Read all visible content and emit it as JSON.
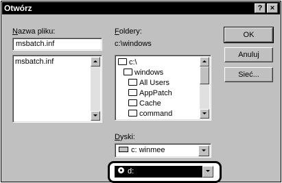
{
  "window": {
    "title": "Otwórz",
    "help_label": "?",
    "close_label": "×"
  },
  "file_name": {
    "label": "Nazwa pliku:",
    "value": "msbatch.inf",
    "files": [
      "msbatch.inf"
    ]
  },
  "folders": {
    "label": "Foldery:",
    "current_path": "c:\\windows",
    "items": [
      "c:\\",
      "windows",
      "All Users",
      "AppPatch",
      "Cache",
      "command"
    ]
  },
  "drives": {
    "label": "Dyski:",
    "selected": "c: winmee",
    "highlighted_option": "d:"
  },
  "buttons": {
    "ok": "OK",
    "cancel": "Anuluj",
    "network": "Sieć..."
  },
  "highlight_color": "#000000"
}
